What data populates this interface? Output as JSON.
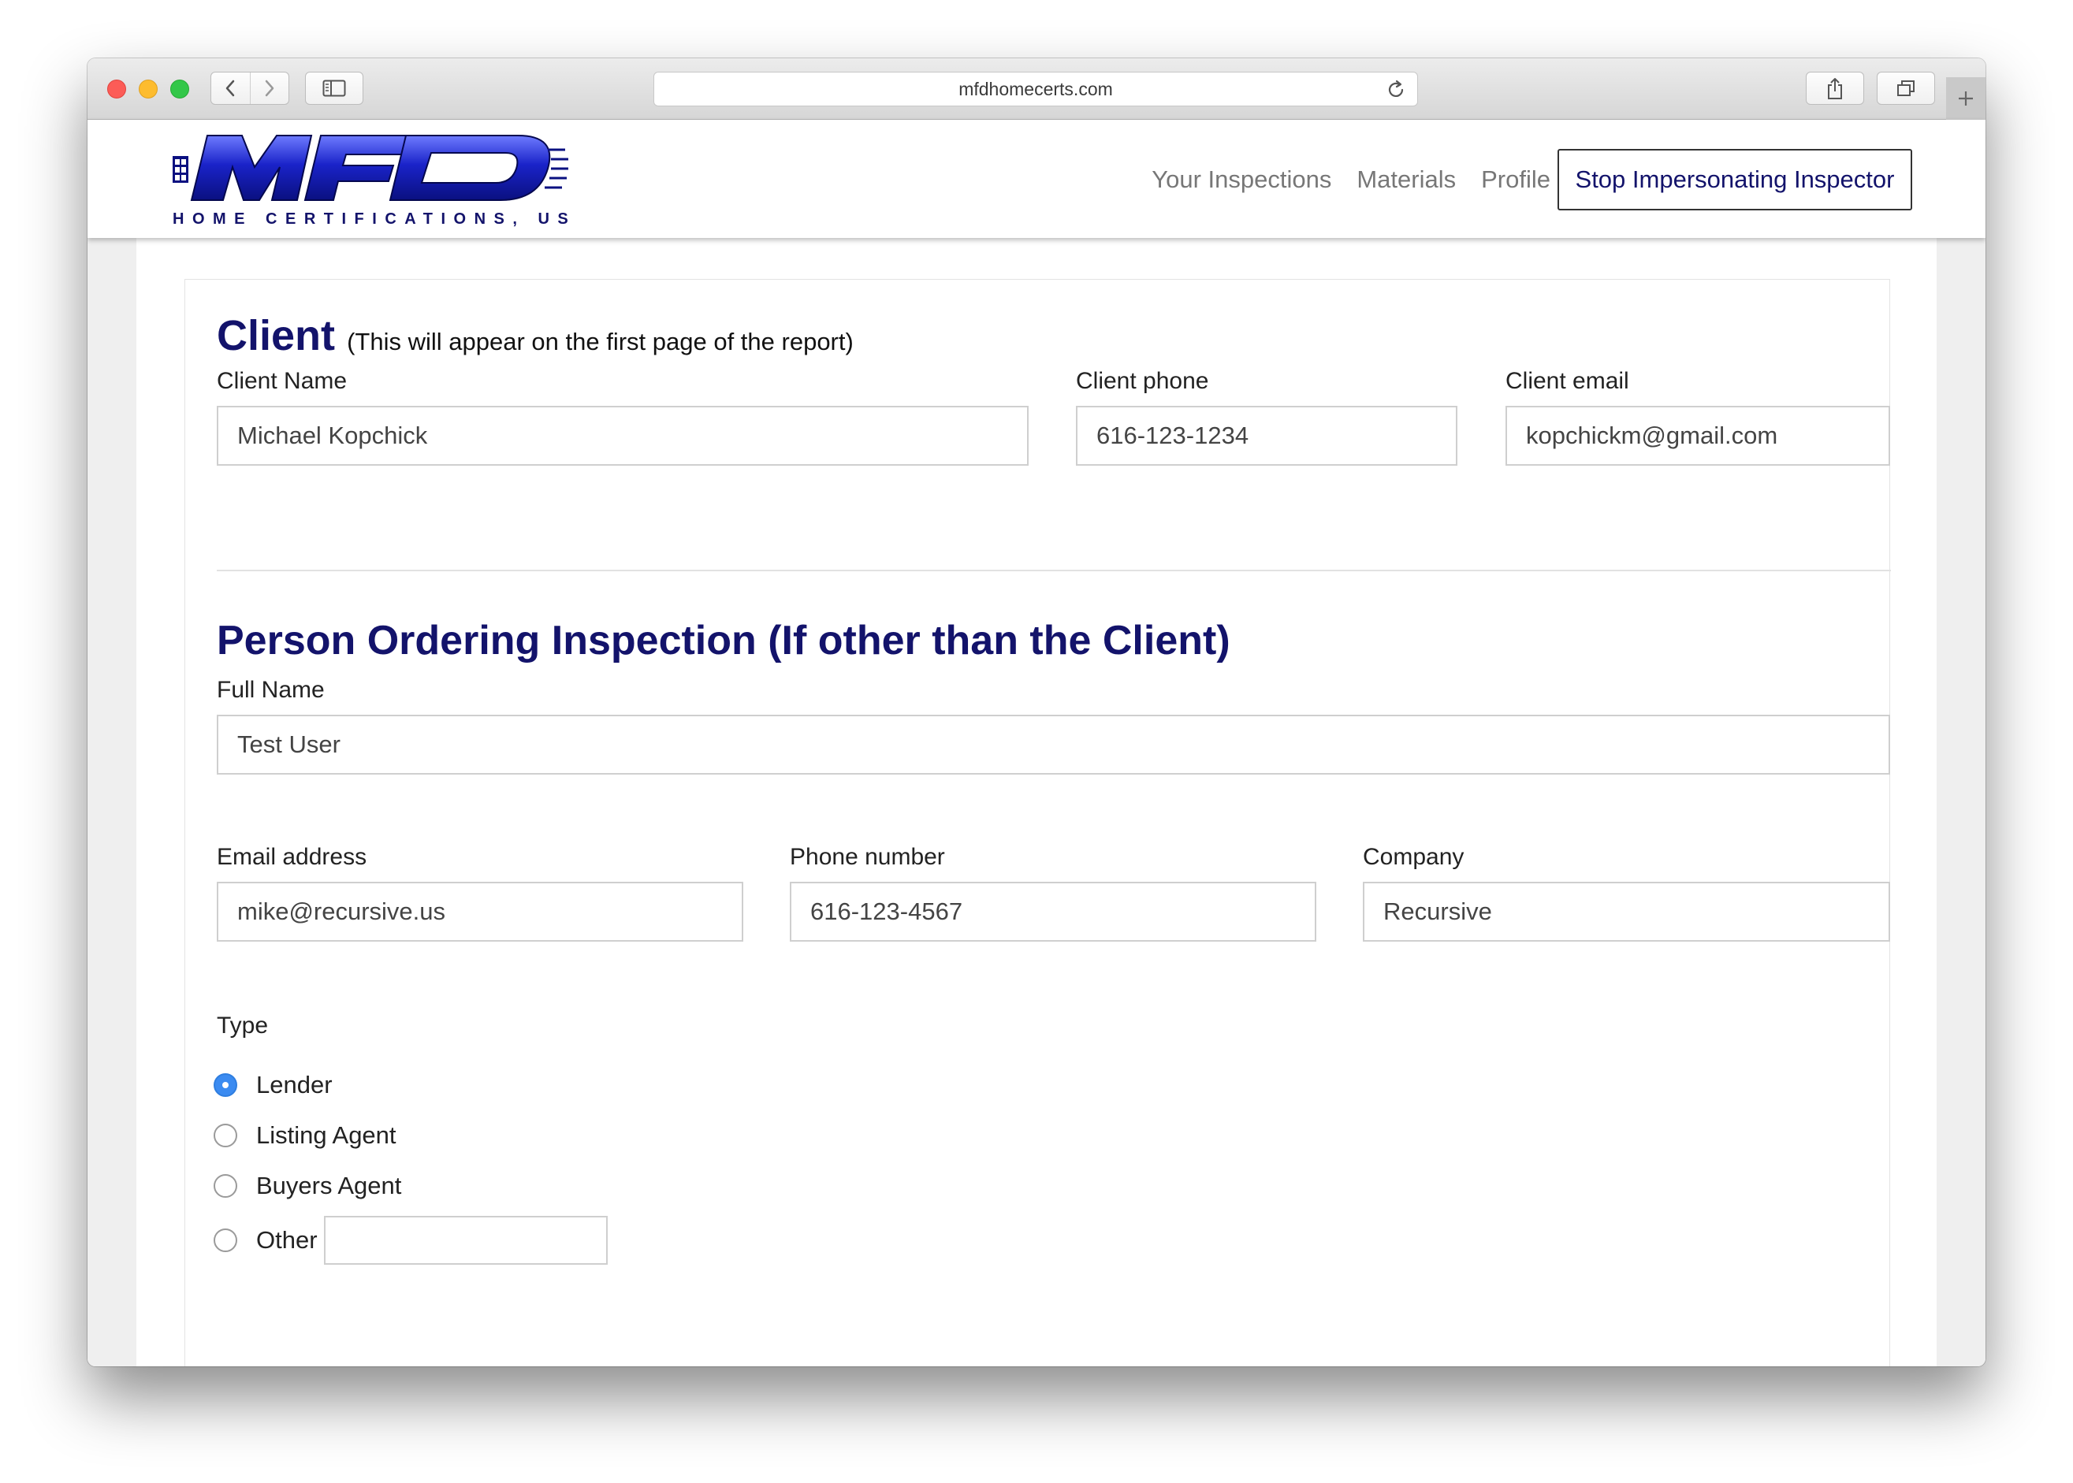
{
  "browser": {
    "url": "mfdhomecerts.com"
  },
  "logo": {
    "wordmark": "MFD",
    "tagline": "HOME CERTIFICATIONS, US LLC"
  },
  "nav": {
    "links": [
      "Your Inspections",
      "Materials",
      "Profile"
    ],
    "stop_button": "Stop Impersonating Inspector"
  },
  "client": {
    "heading": "Client",
    "subheading": "(This will appear on the first page of the report)",
    "name_label": "Client Name",
    "name_value": "Michael Kopchick",
    "phone_label": "Client phone",
    "phone_value": "616-123-1234",
    "email_label": "Client email",
    "email_value": "kopchickm@gmail.com"
  },
  "orderer": {
    "heading": "Person Ordering Inspection (If other than the Client)",
    "full_name_label": "Full Name",
    "full_name_value": "Test User",
    "email_label": "Email address",
    "email_value": "mike@recursive.us",
    "phone_label": "Phone number",
    "phone_value": "616-123-4567",
    "company_label": "Company",
    "company_value": "Recursive",
    "type_label": "Type",
    "type_options": [
      "Lender",
      "Listing Agent",
      "Buyers Agent",
      "Other"
    ],
    "selected_type": "Lender",
    "other_value": ""
  },
  "colors": {
    "heading": "#13136b",
    "radio_selected": "#3b8bf1",
    "logo_blue": "#1a23c9"
  },
  "icons": [
    "back-icon",
    "forward-icon",
    "sidebar-icon",
    "reload-icon",
    "share-icon",
    "tabs-icon",
    "plus-icon",
    "caret-down-icon"
  ]
}
